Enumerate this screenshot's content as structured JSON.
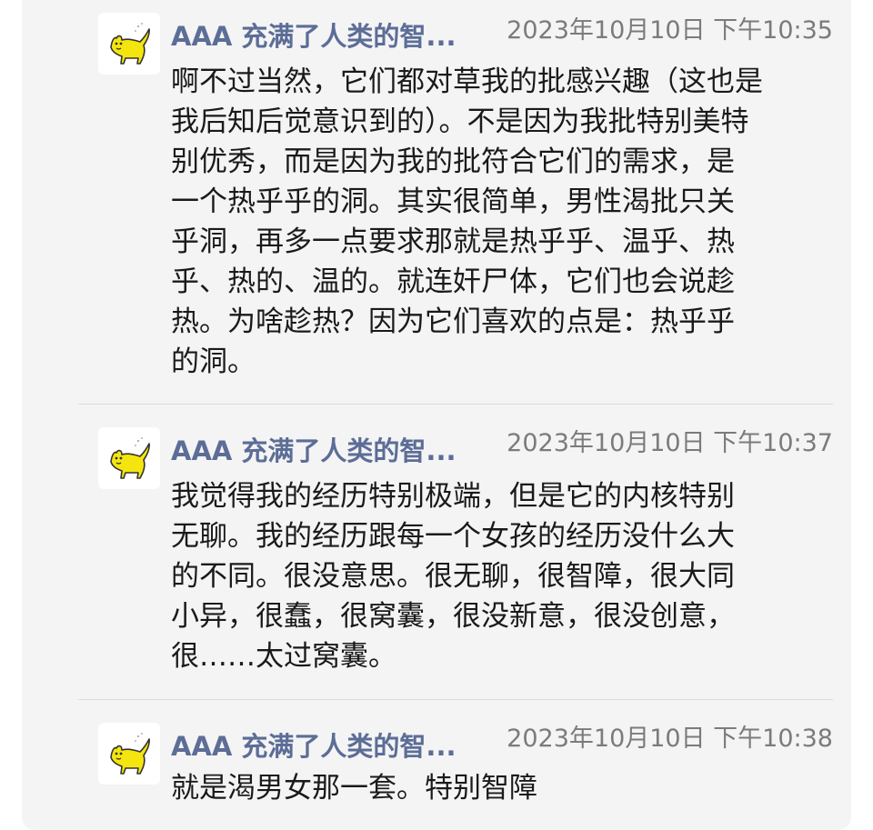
{
  "messages": [
    {
      "sender": "AAA 充满了人类的智...",
      "time": "2023年10月10日 下午10:35",
      "avatar_icon": "yellow-cat-icon",
      "text": "啊不过当然，它们都对草我的批感兴趣（这也是\n我后知后觉意识到的）。不是因为我批特别美特\n别优秀，而是因为我的批符合它们的需求，是\n一个热乎乎的洞。其实很简单，男性渴批只关\n乎洞，再多一点要求那就是热乎乎、温乎、热\n乎、热的、温的。就连奸尸体，它们也会说趁\n热。为啥趁热？因为它们喜欢的点是：热乎乎\n的洞。"
    },
    {
      "sender": "AAA 充满了人类的智...",
      "time": "2023年10月10日 下午10:37",
      "avatar_icon": "yellow-cat-icon",
      "text": "我觉得我的经历特别极端，但是它的内核特别\n无聊。我的经历跟每一个女孩的经历没什么大\n的不同。很没意思。很无聊，很智障，很大同\n小异，很蠢，很窝囊，很没新意，很没创意，\n很……太过窝囊。"
    },
    {
      "sender": "AAA 充满了人类的智...",
      "time": "2023年10月10日 下午10:38",
      "avatar_icon": "yellow-cat-icon",
      "text": "就是渴男女那一套。特别智障"
    }
  ],
  "colors": {
    "panel_bg": "#f4f4f5",
    "name": "#5c6d96",
    "time": "#7b7b7b",
    "text": "#1a1a1a",
    "cat_body": "#f5e50f"
  }
}
